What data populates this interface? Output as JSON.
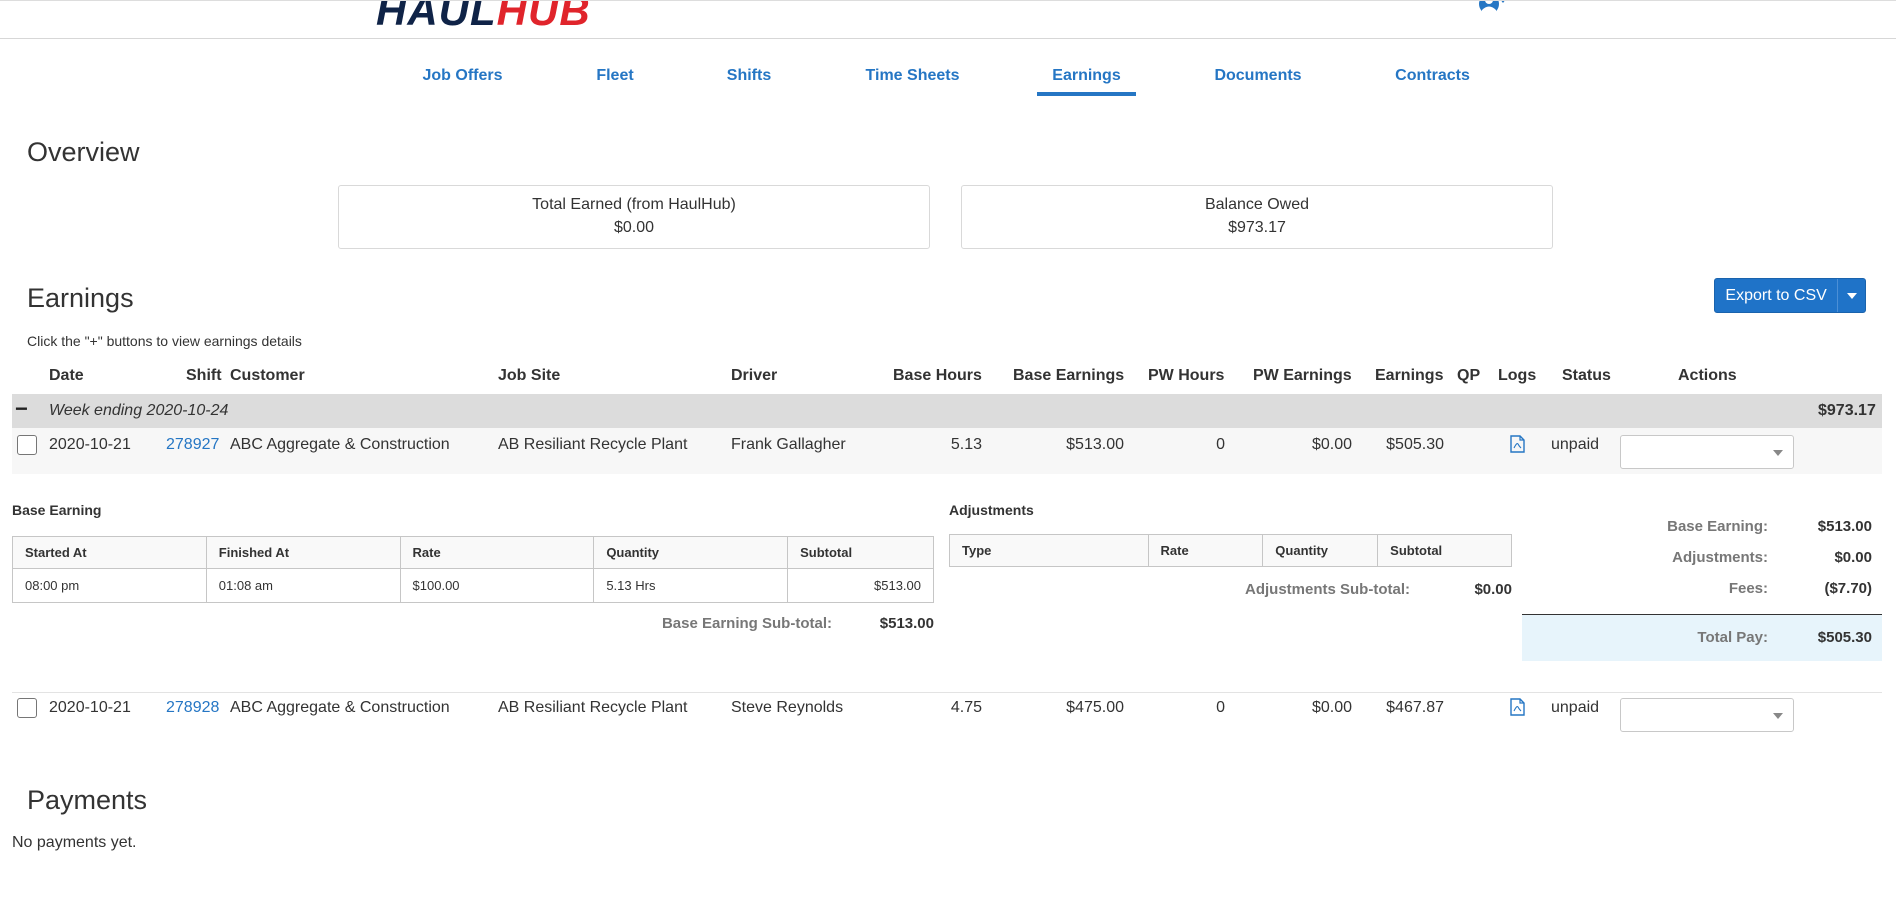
{
  "app": {
    "logo_part1": "HAUL",
    "logo_part2": "HUB"
  },
  "nav": {
    "tabs": [
      {
        "label": "Job Offers",
        "active": false
      },
      {
        "label": "Fleet",
        "active": false
      },
      {
        "label": "Shifts",
        "active": false
      },
      {
        "label": "Time Sheets",
        "active": false
      },
      {
        "label": "Earnings",
        "active": true
      },
      {
        "label": "Documents",
        "active": false
      },
      {
        "label": "Contracts",
        "active": false
      }
    ]
  },
  "overview": {
    "title": "Overview",
    "total_earned_label": "Total Earned (from HaulHub)",
    "total_earned_value": "$0.00",
    "balance_owed_label": "Balance Owed",
    "balance_owed_value": "$973.17"
  },
  "earnings": {
    "title": "Earnings",
    "export_label": "Export to CSV",
    "hint": "Click the \"+\" buttons to view earnings details",
    "columns": [
      "Date",
      "Shift",
      "Customer",
      "Job Site",
      "Driver",
      "Base Hours",
      "Base Earnings",
      "PW Hours",
      "PW Earnings",
      "Earnings",
      "QP",
      "Logs",
      "Status",
      "Actions"
    ],
    "week": {
      "toggle": "−",
      "label": "Week ending 2020-10-24",
      "total": "$973.17"
    },
    "rows": [
      {
        "date": "2020-10-21",
        "shift": "278927",
        "customer": "ABC Aggregate & Construction",
        "job_site": "AB Resiliant Recycle Plant",
        "driver": "Frank Gallagher",
        "base_hours": "5.13",
        "base_earnings": "$513.00",
        "pw_hours": "0",
        "pw_earnings": "$0.00",
        "earnings": "$505.30",
        "status": "unpaid"
      },
      {
        "date": "2020-10-21",
        "shift": "278928",
        "customer": "ABC Aggregate & Construction",
        "job_site": "AB Resiliant Recycle Plant",
        "driver": "Steve Reynolds",
        "base_hours": "4.75",
        "base_earnings": "$475.00",
        "pw_hours": "0",
        "pw_earnings": "$0.00",
        "earnings": "$467.87",
        "status": "unpaid"
      }
    ],
    "detail": {
      "base_title": "Base Earning",
      "base_columns": [
        "Started At",
        "Finished At",
        "Rate",
        "Quantity",
        "Subtotal"
      ],
      "base_row": [
        "08:00 pm",
        "01:08 am",
        "$100.00",
        "5.13 Hrs",
        "$513.00"
      ],
      "base_subtotal_label": "Base Earning Sub-total:",
      "base_subtotal_value": "$513.00",
      "adj_title": "Adjustments",
      "adj_columns": [
        "Type",
        "Rate",
        "Quantity",
        "Subtotal"
      ],
      "adj_subtotal_label": "Adjustments Sub-total:",
      "adj_subtotal_value": "$0.00",
      "summary": {
        "base_label": "Base Earning:",
        "base_value": "$513.00",
        "adj_label": "Adjustments:",
        "adj_value": "$0.00",
        "fees_label": "Fees:",
        "fees_value": "($7.70)",
        "total_label": "Total Pay:",
        "total_value": "$505.30"
      }
    }
  },
  "payments": {
    "title": "Payments",
    "empty": "No payments yet."
  },
  "colors": {
    "accent": "#2576c4",
    "logo_dark": "#0f2347",
    "logo_red": "#e0242b",
    "total_bg": "#e7f4fb"
  }
}
